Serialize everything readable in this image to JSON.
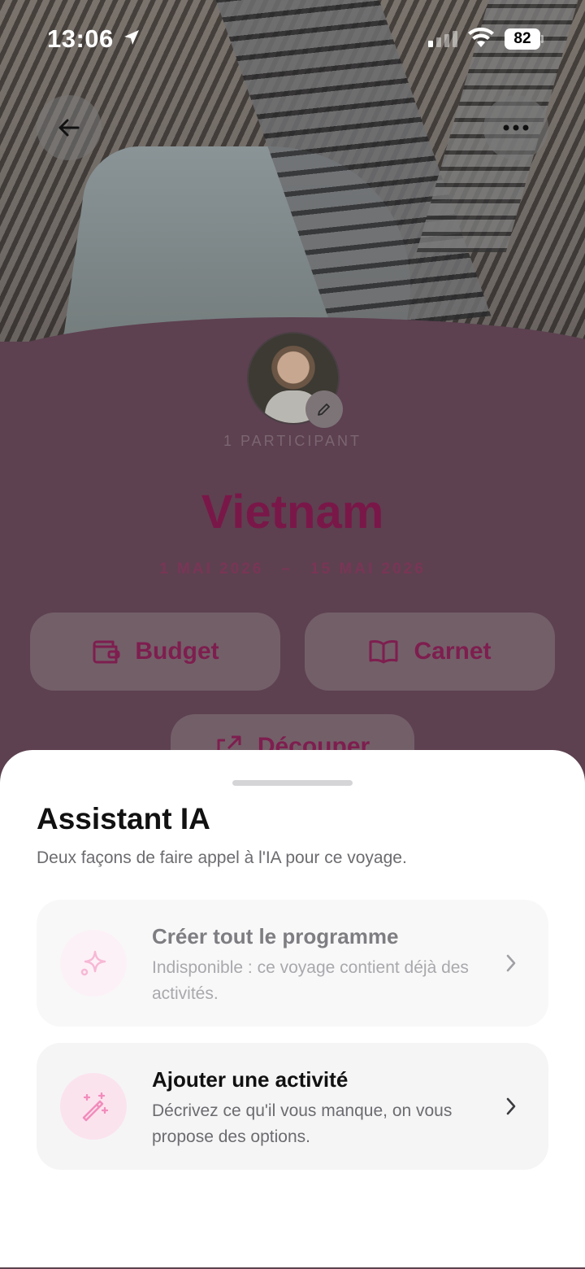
{
  "status_bar": {
    "time": "13:06",
    "battery": "82"
  },
  "trip": {
    "participants": "1 PARTICIPANT",
    "title": "Vietnam",
    "start_date": "1 MAI 2026",
    "date_separator": "–",
    "end_date": "15 MAI 2026"
  },
  "actions": {
    "budget_label": "Budget",
    "carnet_label": "Carnet",
    "share_label": "Découper"
  },
  "sheet": {
    "title": "Assistant IA",
    "subtitle": "Deux façons de faire appel à l'IA pour ce voyage.",
    "options": [
      {
        "title": "Créer tout le programme",
        "description": "Indisponible : ce voyage contient déjà des activités.",
        "icon": "sparkles-icon",
        "enabled": false
      },
      {
        "title": "Ajouter une activité",
        "description": "Décrivez ce qu'il vous manque, on vous propose des options.",
        "icon": "magic-wand-icon",
        "enabled": true
      }
    ]
  },
  "colors": {
    "accent": "#7a1749",
    "sheet_background": "#ffffff",
    "icon_pink": "#f28cbc"
  }
}
